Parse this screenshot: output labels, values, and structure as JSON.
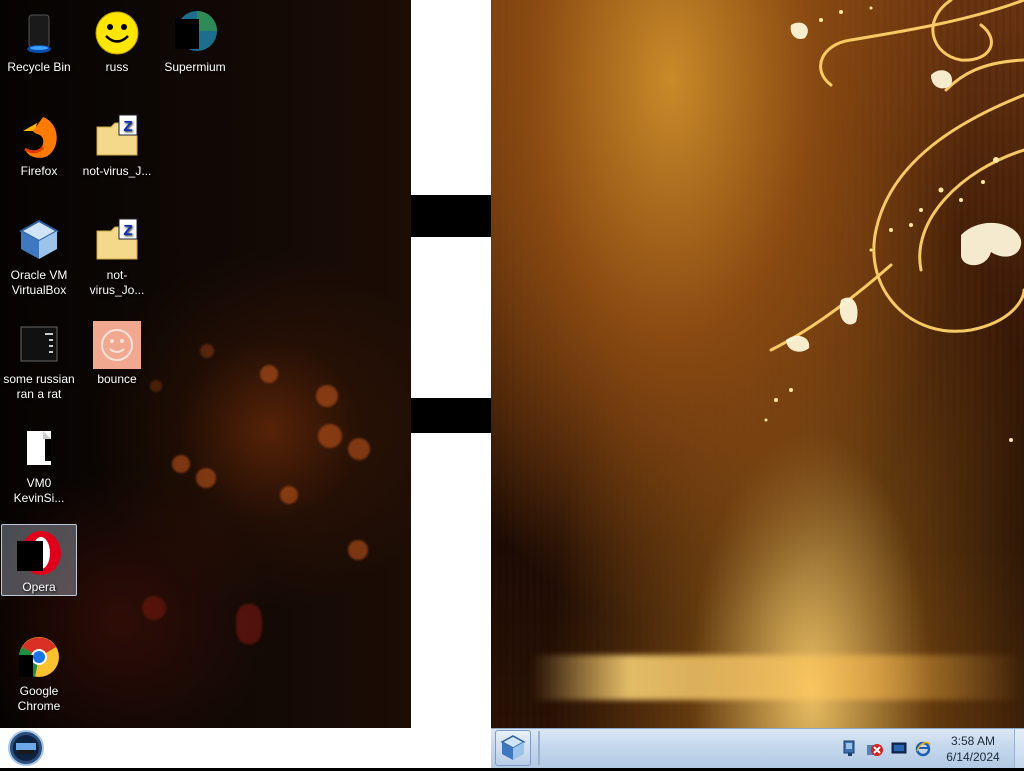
{
  "desktop": {
    "icons": [
      {
        "label": "Recycle Bin",
        "icon": "recycle-bin-icon",
        "selected": false
      },
      {
        "label": "russ",
        "icon": "smiley-icon",
        "selected": false
      },
      {
        "label": "Supermium",
        "icon": "supermium-browser-icon",
        "selected": false
      },
      {
        "label": "Firefox",
        "icon": "firefox-icon",
        "selected": false
      },
      {
        "label": "not-virus_J...",
        "icon": "zip-folder-icon",
        "selected": false
      },
      {
        "label": "Oracle VM VirtualBox",
        "icon": "virtualbox-icon",
        "selected": false
      },
      {
        "label": "not-virus_Jo...",
        "icon": "zip-folder-icon",
        "selected": false
      },
      {
        "label": "some russian ran a rat",
        "icon": "dark-app-icon",
        "selected": false
      },
      {
        "label": "bounce",
        "icon": "bounce-smiley-icon",
        "selected": false
      },
      {
        "label": "VM0 KevinSi...",
        "icon": "document-shortcut-icon",
        "selected": false
      },
      {
        "label": "Opera",
        "icon": "opera-icon",
        "selected": true
      },
      {
        "label": "Google Chrome",
        "icon": "chrome-icon",
        "selected": false
      }
    ]
  },
  "taskbar": {
    "start": "start-orb-icon",
    "pinned": [
      {
        "name": "Oracle VM VirtualBox",
        "icon": "virtualbox-icon"
      }
    ],
    "tray": [
      {
        "name": "network-icon"
      },
      {
        "name": "error-x-icon"
      },
      {
        "name": "monitor-icon"
      },
      {
        "name": "ie-icon"
      }
    ],
    "clock": {
      "time": "3:58 AM",
      "date": "6/14/2024"
    }
  },
  "colors": {
    "taskbar_bg": "#c3d6ec",
    "selection": "#c8d7eb",
    "wallpaper_gold": "#e8b64a"
  }
}
